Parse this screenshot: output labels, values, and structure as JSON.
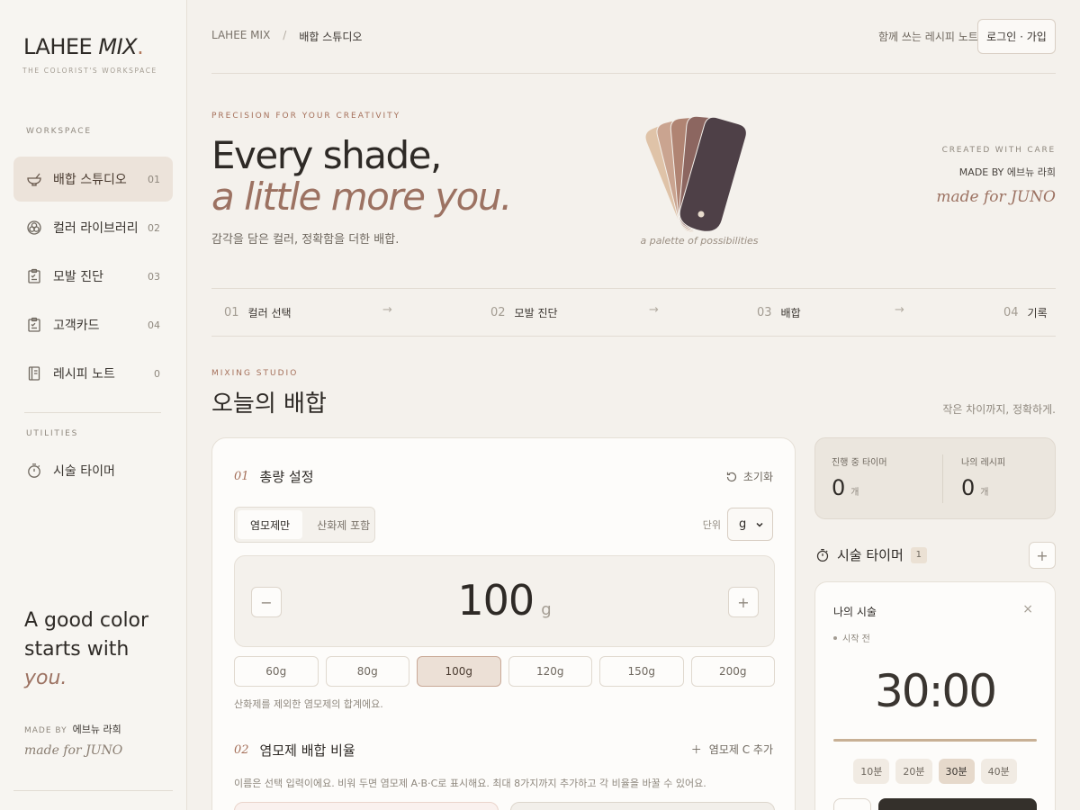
{
  "brand": {
    "name": "LAHEE",
    "mix": "MIX",
    "dot": ".",
    "subtitle": "THE COLORIST'S WORKSPACE"
  },
  "sidebar": {
    "workspace_label": "WORKSPACE",
    "items": [
      {
        "label": "배합 스튜디오",
        "num": "01",
        "icon": "mixing-bowl-icon"
      },
      {
        "label": "컬러 라이브러리",
        "num": "02",
        "icon": "palette-icon"
      },
      {
        "label": "모발 진단",
        "num": "03",
        "icon": "clipboard-icon"
      },
      {
        "label": "고객카드",
        "num": "04",
        "icon": "clipboard-icon"
      },
      {
        "label": "레시피 노트",
        "num": "0",
        "icon": "notebook-icon"
      }
    ],
    "utilities_label": "UTILITIES",
    "utilities": [
      {
        "label": "시술 타이머",
        "icon": "timer-icon"
      }
    ],
    "tagline": {
      "line1": "A good color",
      "line2": "starts with",
      "line3": "you."
    },
    "made_by_label": "MADE BY",
    "made_by_name": "에브뉴 라희",
    "made_for": "made for JUNO"
  },
  "header": {
    "crumb_root": "LAHEE MIX",
    "crumb_sep": "/",
    "crumb_current": "배합 스튜디오",
    "note": "함께 쓰는 레시피 노트",
    "login_label": "로그인 · 가입"
  },
  "hero": {
    "eyebrow": "PRECISION FOR YOUR CREATIVITY",
    "title_line1": "Every shade,",
    "title_line2": "a little more you.",
    "subtitle": "감각을 담은 컬러, 정확함을 더한 배합.",
    "swatch_caption": "a palette of possibilities",
    "swatch_colors": [
      "#dfc3a8",
      "#caa490",
      "#b08473",
      "#8c6660",
      "#4e4047"
    ],
    "created_label": "CREATED WITH CARE",
    "made_by": "MADE BY 에브뉴 라희",
    "made_for": "made for JUNO"
  },
  "steps": [
    {
      "num": "01",
      "label": "컬러 선택"
    },
    {
      "num": "02",
      "label": "모발 진단"
    },
    {
      "num": "03",
      "label": "배합"
    },
    {
      "num": "04",
      "label": "기록"
    }
  ],
  "step_arrow": "→",
  "studio": {
    "eyebrow": "MIXING STUDIO",
    "title": "오늘의 배합",
    "note": "작은 차이까지, 정확하게."
  },
  "total": {
    "num": "01",
    "title": "총량 설정",
    "reset_label": "초기화",
    "mode_options": [
      "염모제만",
      "산화제 포함"
    ],
    "mode_selected": "염모제만",
    "unit_label": "단위",
    "unit_value": "g",
    "amount": "100",
    "amount_unit": "g",
    "minus": "−",
    "plus": "+",
    "presets": [
      "60g",
      "80g",
      "100g",
      "120g",
      "150g",
      "200g"
    ],
    "preset_selected": "100g",
    "hint": "산화제를 제외한 염모제의 합계에요."
  },
  "ratio": {
    "num": "02",
    "title": "염모제 배합 비율",
    "add_label": "염모제 C 추가",
    "hint": "이름은 선택 입력이에요. 비워 두면 염모제 A·B·C로 표시해요. 최대 8가지까지 추가하고 각 비율을 바꿀 수 있어요."
  },
  "stats": {
    "timers_label": "진행 중 타이머",
    "timers_value": "0",
    "recipes_label": "나의 레시피",
    "recipes_value": "0",
    "unit": "개"
  },
  "timer": {
    "title": "시술 타이머",
    "count": "1",
    "add": "+",
    "card_name": "나의 시술",
    "close": "×",
    "status": "시작 전",
    "time": "30:00",
    "progress": 1.0,
    "presets": [
      "10분",
      "20분",
      "30분",
      "40분"
    ],
    "preset_selected": "30분"
  }
}
